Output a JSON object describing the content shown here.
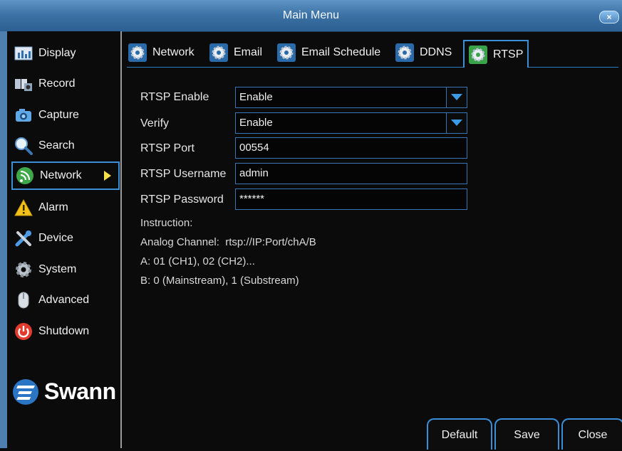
{
  "window": {
    "title": "Main Menu",
    "close_glyph": "×"
  },
  "sidebar": {
    "items": [
      {
        "label": "Display",
        "icon": "display-icon"
      },
      {
        "label": "Record",
        "icon": "record-icon"
      },
      {
        "label": "Capture",
        "icon": "camera-icon"
      },
      {
        "label": "Search",
        "icon": "search-icon"
      },
      {
        "label": "Network",
        "icon": "network-icon",
        "active": true
      },
      {
        "label": "Alarm",
        "icon": "alarm-icon"
      },
      {
        "label": "Device",
        "icon": "device-icon"
      },
      {
        "label": "System",
        "icon": "system-icon"
      },
      {
        "label": "Advanced",
        "icon": "advanced-icon"
      },
      {
        "label": "Shutdown",
        "icon": "shutdown-icon"
      }
    ],
    "logo_text": "Swann"
  },
  "tabs": [
    {
      "label": "Network"
    },
    {
      "label": "Email"
    },
    {
      "label": "Email Schedule"
    },
    {
      "label": "DDNS"
    },
    {
      "label": "RTSP",
      "active": true
    }
  ],
  "form": {
    "rtsp_enable": {
      "label": "RTSP Enable",
      "value": "Enable"
    },
    "verify": {
      "label": "Verify",
      "value": "Enable"
    },
    "rtsp_port": {
      "label": "RTSP Port",
      "value": "00554"
    },
    "rtsp_username": {
      "label": "RTSP Username",
      "value": "admin"
    },
    "rtsp_password": {
      "label": "RTSP Password",
      "value": "******"
    }
  },
  "instructions": {
    "heading": "Instruction:",
    "line1": "Analog Channel:  rtsp://IP:Port/chA/B",
    "line2": "A: 01 (CH1), 02 (CH2)...",
    "line3": "B: 0 (Mainstream), 1 (Substream)"
  },
  "buttons": {
    "default": "Default",
    "save": "Save",
    "close": "Close"
  },
  "colors": {
    "accent": "#3c8fd6",
    "title_bar": "#3d73a6",
    "background": "#0b0b0b",
    "arrow": "#f7e14a"
  }
}
